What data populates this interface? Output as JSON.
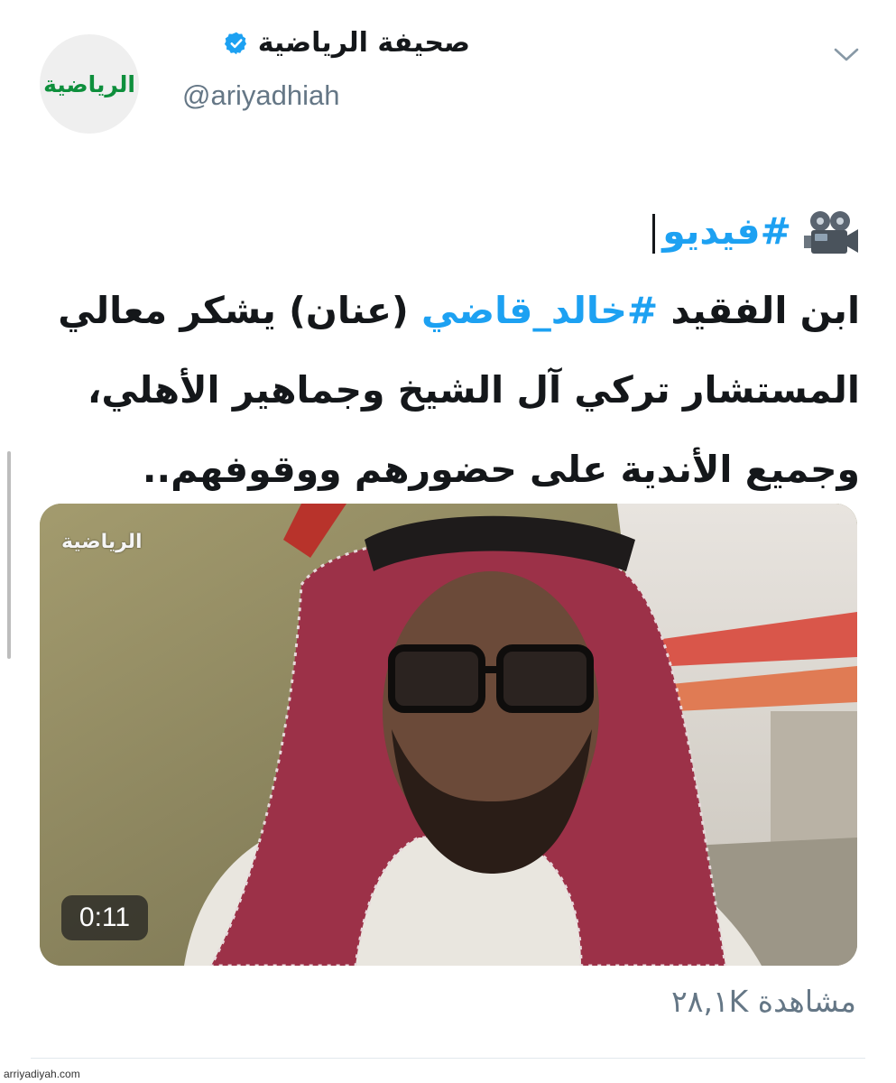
{
  "header": {
    "avatar_logo_text": "الرياضية",
    "display_name": "صحيفة الرياضية",
    "handle": "@ariyadhiah",
    "verified_icon": "verified-badge-icon",
    "menu_icon": "chevron-down-icon"
  },
  "tweet": {
    "camera_icon": "movie-camera-icon",
    "line1_hashtag": "#فيديو",
    "line2_part1": "ابن الفقيد ",
    "line2_hashtag": "#خالد_قاضي",
    "line2_part2": " (عنان) يشكر معالي",
    "line3": "المستشار تركي آل الشيخ وجماهير الأهلي،",
    "line4": "وجميع الأندية على حضورهم ووقوفهم.."
  },
  "video": {
    "watermark": "الرياضية",
    "duration": "0:11"
  },
  "footer": {
    "views": "مشاهدة ٢٨,١K"
  },
  "site_credit": "arriyadiyah.com",
  "colors": {
    "hashtag": "#1da1f2",
    "secondary_text": "#657786",
    "verified": "#1da1f2"
  }
}
